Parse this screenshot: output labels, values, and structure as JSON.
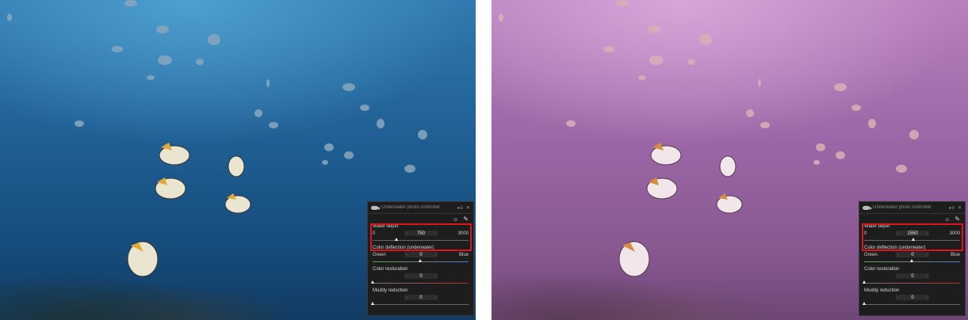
{
  "panel": {
    "title": "Underwater photo controller",
    "window_icons": [
      "pin-icon",
      "close-icon"
    ],
    "tool_icons": [
      "sun-icon",
      "dropper-icon"
    ],
    "water_depth": {
      "label": "Water depth",
      "min": "0",
      "max": "3000"
    },
    "color_deflection": {
      "label": "Color deflection (underwater)",
      "left": "Green",
      "right": "Blue",
      "value": "0"
    },
    "color_restoration": {
      "label": "Color restoration",
      "value": "0"
    },
    "muddy_reduction": {
      "label": "Muddy reduction",
      "value": "0"
    }
  },
  "before": {
    "water_depth_value": "750"
  },
  "after": {
    "water_depth_value": "1550"
  },
  "colors": {
    "highlight": "#e0141e",
    "water_before": "#1f5e93",
    "water_after": "#9c66a6"
  }
}
